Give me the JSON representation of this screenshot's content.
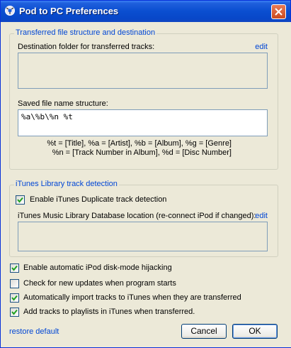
{
  "window": {
    "title": "Pod to PC Preferences"
  },
  "transfer": {
    "group_title": "Transferred file structure and destination",
    "dest_label": "Destination folder for transferred tracks:",
    "dest_edit": "edit",
    "dest_value": "",
    "name_label": "Saved file name structure:",
    "name_value": "%a\\%b\\%n %t",
    "help_line1": "%t = [Title], %a = [Artist], %b = [Album], %g = [Genre]",
    "help_line2": "%n = [Track Number in Album], %d = [Disc Number]"
  },
  "itunes": {
    "group_title": "iTunes Library track detection",
    "dup_label": "Enable iTunes Duplicate track detection",
    "dup_checked": true,
    "db_label": "iTunes Music Library Database location (re-connect iPod if changed):",
    "db_edit": "edit",
    "db_value": ""
  },
  "options": [
    {
      "label": "Enable automatic iPod disk-mode hijacking",
      "checked": true
    },
    {
      "label": "Check for new updates when program starts",
      "checked": false
    },
    {
      "label": "Automatically import tracks to iTunes when they are transferred",
      "checked": true
    },
    {
      "label": "Add tracks to playlists in iTunes when transferred.",
      "checked": true
    }
  ],
  "footer": {
    "restore_label": "restore default",
    "cancel_label": "Cancel",
    "ok_label": "OK"
  },
  "colors": {
    "title_bar": "#0a4ed0",
    "group_title": "#0046d5",
    "face": "#ece9d8"
  }
}
